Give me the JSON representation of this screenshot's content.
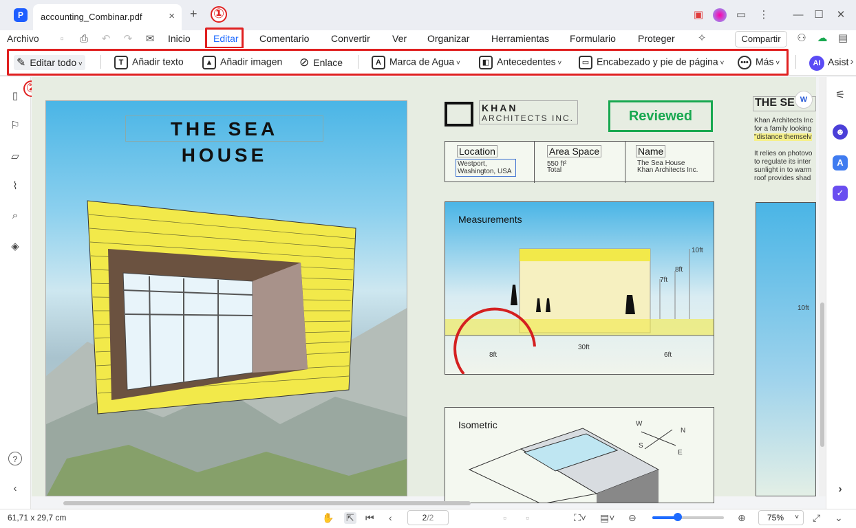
{
  "tab": {
    "title": "accounting_Combinar.pdf",
    "close": "×",
    "new": "+"
  },
  "markers": {
    "one": "①",
    "two": "②"
  },
  "menu": {
    "items": [
      "Archivo",
      "Inicio",
      "Editar",
      "Comentario",
      "Convertir",
      "Ver",
      "Organizar",
      "Herramientas",
      "Formulario",
      "Proteger"
    ],
    "share": "Compartir"
  },
  "tools": {
    "edit_all": "Editar todo",
    "add_text": "Añadir texto",
    "add_image": "Añadir imagen",
    "link": "Enlace",
    "watermark": "Marca de Agua",
    "background": "Antecedentes",
    "header_footer": "Encabezado y pie de página",
    "more": "Más",
    "assistant": "Asist",
    "ai": "AI"
  },
  "document": {
    "poster_title": "THE SEA HOUSE",
    "company_line1": "KHAN",
    "company_line2": "ARCHITECTS INC.",
    "stamp": "Reviewed",
    "location_label": "Location",
    "location_value": "Westport, Washington, USA",
    "area_label": "Area Space",
    "area_value": "550 ft²",
    "area_sub": "Total",
    "name_label": "Name",
    "name_value1": "The Sea House",
    "name_value2": "Khan Architects Inc.",
    "measurements": "Measurements",
    "dims": [
      "10ft",
      "8ft",
      "7ft",
      "8ft",
      "30ft",
      "6ft",
      "10ft"
    ],
    "isometric": "Isometric",
    "compass": [
      "W",
      "N",
      "S",
      "E"
    ],
    "side_title": "THE SE",
    "side_text": [
      "Khan Architects Inc",
      "for a family looking",
      "\"distance themselv",
      "It relies on photovo",
      "to regulate its inter",
      "sunlight in to warm",
      "roof provides shad"
    ]
  },
  "status": {
    "dimensions": "61,71 x 29,7 cm",
    "page": "2",
    "page_total": "/2",
    "zoom": "75%"
  }
}
